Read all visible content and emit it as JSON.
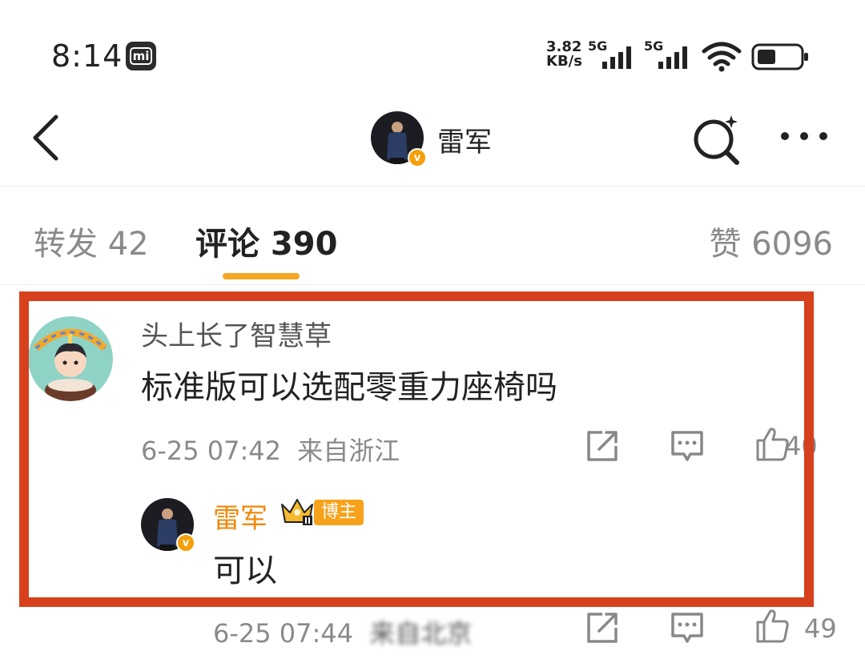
{
  "status_bar": {
    "time": "8:14",
    "mi_icon": "mi",
    "speed_value": "3.82",
    "speed_unit": "KB/s",
    "net1": "5G",
    "net2": "5G"
  },
  "header": {
    "title": "雷军"
  },
  "tabs": [
    {
      "label": "转发 42"
    },
    {
      "label": "评论 390"
    },
    {
      "label": "赞 6096"
    }
  ],
  "comment": {
    "username": "头上长了智慧草",
    "text": "标准版可以选配零重力座椅吗",
    "time": "6-25 07:42",
    "location": "来自浙江",
    "likes": "40"
  },
  "reply": {
    "username": "雷军",
    "badge": "博主",
    "text": "可以",
    "time": "6-25 07:44",
    "location": "来自北京",
    "likes": "49"
  },
  "colors": {
    "accent_orange": "#f5a623",
    "highlight_red": "#d7401c",
    "name_orange": "#f28705"
  }
}
